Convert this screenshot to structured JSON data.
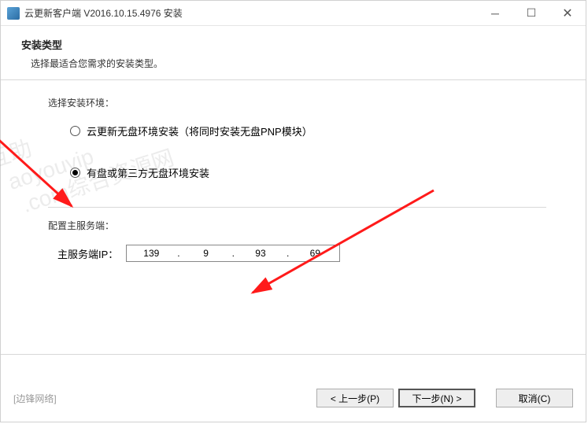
{
  "window": {
    "title": "云更新客户端 V2016.10.15.4976 安装"
  },
  "header": {
    "title": "安装类型",
    "subtitle": "选择最适合您需求的安装类型。"
  },
  "env": {
    "label": "选择安装环境：",
    "option1": "云更新无盘环境安装（将同时安装无盘PNP模块）",
    "option2": "有盘或第三方无盘环境安装",
    "selected": "option2"
  },
  "server": {
    "label": "配置主服务端：",
    "ip_label": "主服务端IP：",
    "ip": {
      "a": "139",
      "b": "9",
      "c": "93",
      "d": "69"
    }
  },
  "footer": {
    "vendor": "[边锋网络]",
    "back": "< 上一步(P)",
    "next": "下一步(N) >",
    "cancel": "取消(C)"
  },
  "watermark": "互助\n  aoyouvip\n   .com综合资源网"
}
